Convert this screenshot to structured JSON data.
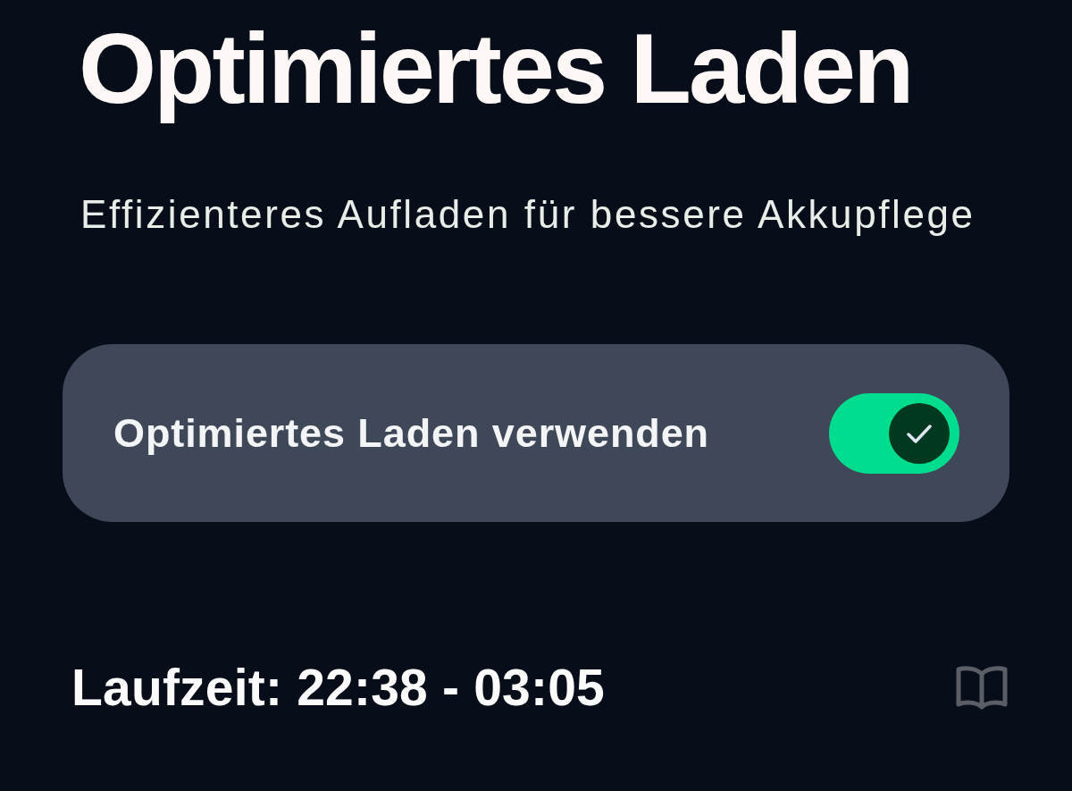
{
  "title": "Optimiertes Laden",
  "subtitle": "Effizienteres Aufladen für bessere Akkupflege",
  "setting": {
    "label": "Optimiertes Laden verwenden",
    "on": true
  },
  "runtime": {
    "text": "Laufzeit: 22:38 - 03:05"
  }
}
